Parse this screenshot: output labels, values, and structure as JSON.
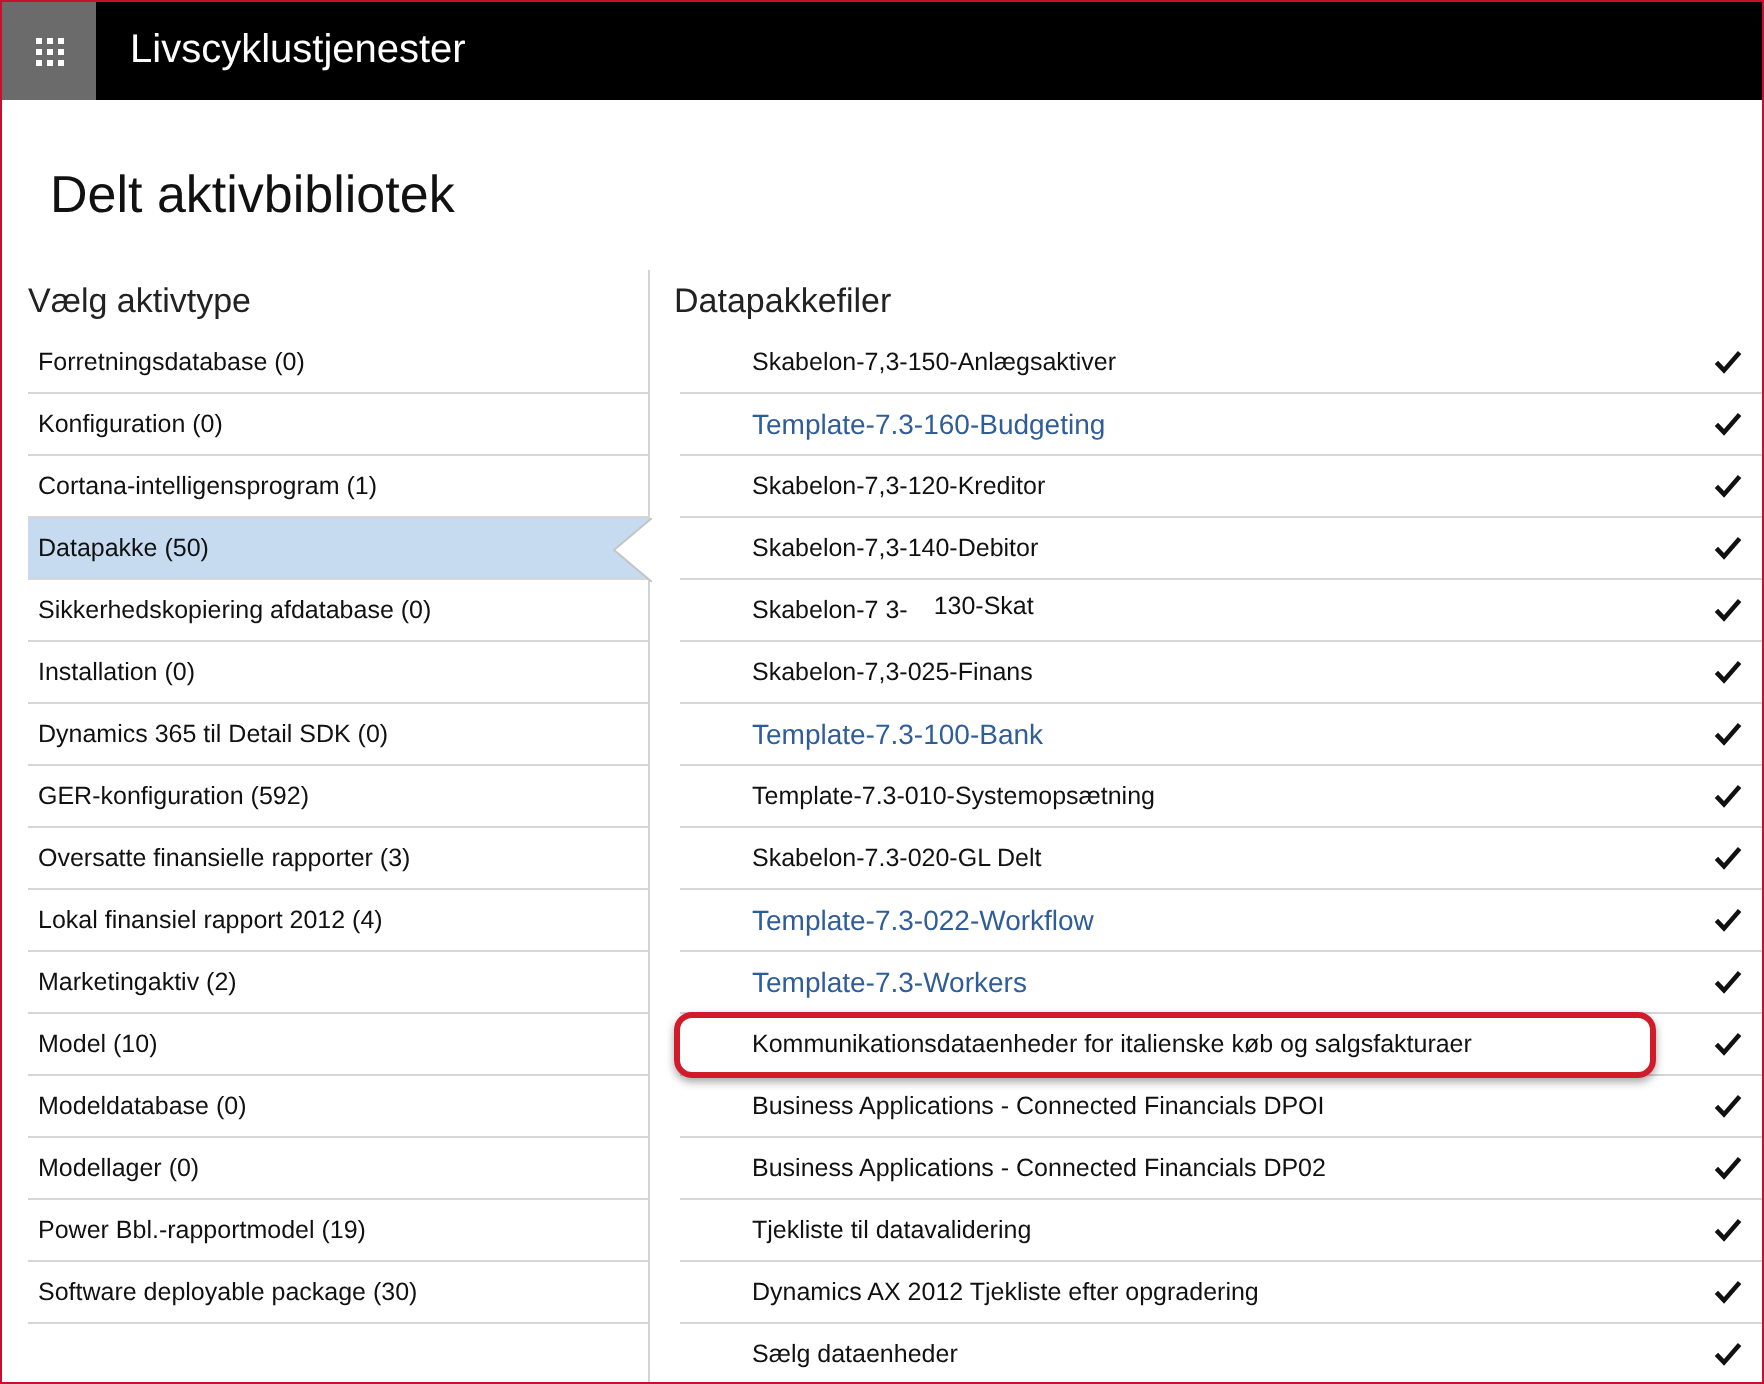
{
  "header": {
    "title": "Livscyklustjenester"
  },
  "page": {
    "title": "Delt aktivbibliotek"
  },
  "asset_types": {
    "heading": "Vælg aktivtype",
    "items": [
      {
        "label": "Forretningsdatabase (0)",
        "selected": false
      },
      {
        "label": "Konfiguration (0)",
        "selected": false
      },
      {
        "label": "Cortana-intelligensprogram (1)",
        "selected": false
      },
      {
        "label": "Datapakke (50)",
        "selected": true
      },
      {
        "label": "Sikkerhedskopiering afdatabase (0)",
        "selected": false
      },
      {
        "label": "Installation (0)",
        "selected": false
      },
      {
        "label": "Dynamics 365 til Detail SDK (0)",
        "selected": false
      },
      {
        "label": "GER-konfiguration (592)",
        "selected": false
      },
      {
        "label": "Oversatte finansielle rapporter (3)",
        "selected": false
      },
      {
        "label": "Lokal finansiel rapport 2012 (4)",
        "selected": false
      },
      {
        "label": "Marketingaktiv (2)",
        "selected": false
      },
      {
        "label": "Model (10)",
        "selected": false
      },
      {
        "label": "Modeldatabase (0)",
        "selected": false
      },
      {
        "label": "Modellager (0)",
        "selected": false
      },
      {
        "label": "Power Bbl.-rapportmodel (19)",
        "selected": false
      },
      {
        "label": "Software deployable package (30)",
        "selected": false
      }
    ]
  },
  "files": {
    "heading": "Datapakkefiler",
    "rows": [
      {
        "kind": "plain",
        "label": "Skabelon-7,3-150-Anlægsaktiver",
        "checked": true,
        "highlighted": false
      },
      {
        "kind": "link",
        "label": "Template-7.3-160-Budgeting",
        "checked": true,
        "highlighted": false
      },
      {
        "kind": "plain",
        "label": "Skabelon-7,3-120-Kreditor",
        "checked": true,
        "highlighted": false
      },
      {
        "kind": "plain",
        "label": "Skabelon-7,3-140-Debitor",
        "checked": true,
        "highlighted": false
      },
      {
        "kind": "plain",
        "label": "Skabelon-7 3-",
        "label_tail": "130-Skat",
        "checked": true,
        "highlighted": false
      },
      {
        "kind": "plain",
        "label": "Skabelon-7,3-025-Finans",
        "checked": true,
        "highlighted": false
      },
      {
        "kind": "link",
        "label": "Template-7.3-100-Bank",
        "checked": true,
        "highlighted": false
      },
      {
        "kind": "plain",
        "label": "Template-7.3-010-Systemopsætning",
        "checked": true,
        "highlighted": false
      },
      {
        "kind": "plain",
        "label": "Skabelon-7.3-020-GL Delt",
        "checked": true,
        "highlighted": false
      },
      {
        "kind": "link",
        "label": "Template-7.3-022-Workflow",
        "checked": true,
        "highlighted": false
      },
      {
        "kind": "link",
        "label": "Template-7.3-Workers",
        "checked": true,
        "highlighted": false
      },
      {
        "kind": "plain",
        "label": "Kommunikationsdataenheder for italienske køb og salgsfakturaer",
        "checked": true,
        "highlighted": true
      },
      {
        "kind": "plain",
        "label": "Business Applications - Connected Financials DPOI",
        "checked": true,
        "highlighted": false
      },
      {
        "kind": "plain",
        "label": "Business Applications - Connected Financials DP02",
        "checked": true,
        "highlighted": false
      },
      {
        "kind": "plain",
        "label": "Tjekliste til datavalidering",
        "checked": true,
        "highlighted": false
      },
      {
        "kind": "plain",
        "label": "Dynamics AX 2012 Tjekliste efter opgradering",
        "checked": true,
        "highlighted": false
      },
      {
        "kind": "plain",
        "label": "Sælg dataenheder",
        "checked": true,
        "highlighted": false
      }
    ]
  }
}
